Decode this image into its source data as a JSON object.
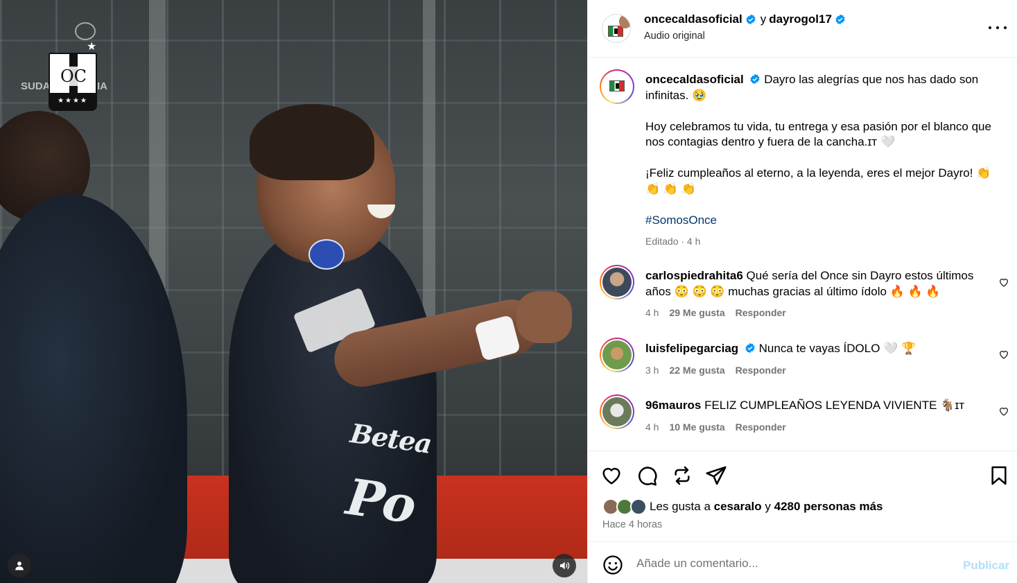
{
  "media": {
    "watermark": {
      "left_text": "SUDA",
      "right_text": "IA",
      "monogram": "OC",
      "stars": "★★★★"
    },
    "sponsor_top": "Betea",
    "sponsor_bottom": "Po",
    "icons": {
      "user_tag": "user-tag-icon",
      "volume": "volume-icon"
    }
  },
  "header": {
    "author": "oncecaldasoficial",
    "connector": "y",
    "collaborator": "dayrogol17",
    "audio": "Audio original"
  },
  "caption": {
    "username": "oncecaldasoficial",
    "line1": "Dayro las alegrías que nos has dado son infinitas. 🥹",
    "line2": "Hoy celebramos tu vida, tu entrega y esa pasión por el blanco que nos contagias dentro y fuera de la cancha.ɪᴛ 🤍",
    "line3": "¡Feliz cumpleaños al eterno, a la leyenda, eres el mejor Dayro! 👏 👏 👏 👏",
    "hashtag": "#SomosOnce",
    "meta": "Editado · 4 h"
  },
  "comments": [
    {
      "username": "carlospiedrahita6",
      "text": "Qué sería del Once sin Dayro estos últimos años 😳 😳 😳 muchas gracias al último ídolo 🔥 🔥 🔥",
      "time": "4 h",
      "likes": "29 Me gusta",
      "reply": "Responder"
    },
    {
      "username": "luisfelipegarciag",
      "text": "Nunca te vayas ÍDOLO 🤍 🏆",
      "time": "3 h",
      "likes": "22 Me gusta",
      "reply": "Responder"
    },
    {
      "username": "96mauros",
      "text": "FELIZ CUMPLEAÑOS LEYENDA VIVIENTE 🐐ɪᴛ",
      "time": "4 h",
      "likes": "10 Me gusta",
      "reply": "Responder"
    }
  ],
  "likes": {
    "prefix": "Les gusta a",
    "user": "cesaralo",
    "joiner": "y",
    "others": "4280 personas más",
    "posted": "Hace 4 horas"
  },
  "composer": {
    "placeholder": "Añade un comentario...",
    "publish": "Publicar"
  },
  "colors": {
    "accent": "#0095f6",
    "verified": "#0095f6",
    "link": "#00376b",
    "muted": "#737373",
    "publish_disabled": "#b2dffc"
  }
}
